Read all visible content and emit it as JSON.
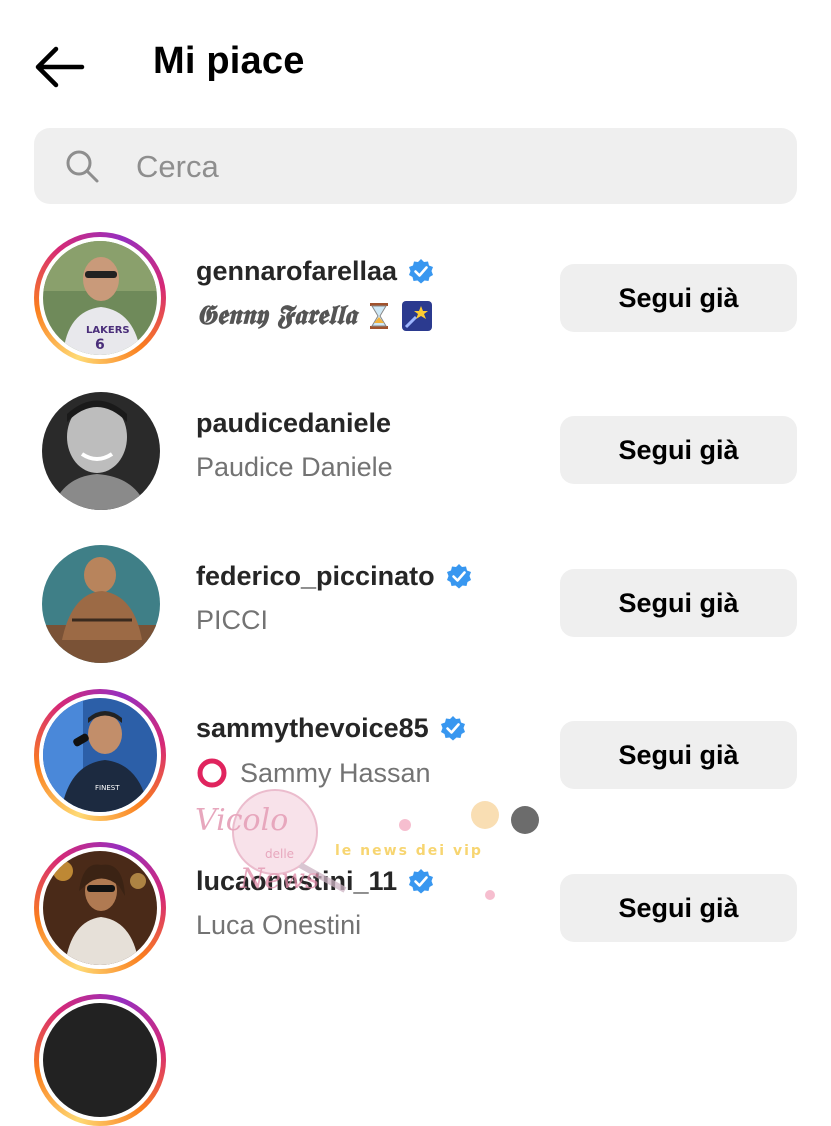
{
  "header": {
    "title": "Mi piace",
    "back_icon": "arrow-left-icon"
  },
  "search": {
    "placeholder": "Cerca",
    "icon": "search-icon"
  },
  "users": [
    {
      "username": "gennarofarellaa",
      "fullname": "𝕲𝖊𝖓𝖓𝖞 𝕱𝖆𝖗𝖊𝖑𝖑𝖆",
      "verified": true,
      "story_ring": true,
      "emojis": [
        "hourglass-emoji",
        "shooting-star-emoji"
      ],
      "button": "Segui già"
    },
    {
      "username": "paudicedaniele",
      "fullname": "Paudice Daniele",
      "verified": false,
      "story_ring": false,
      "button": "Segui già"
    },
    {
      "username": "federico_piccinato",
      "fullname": "PICCI",
      "verified": true,
      "story_ring": false,
      "button": "Segui già"
    },
    {
      "username": "sammythevoice85",
      "fullname": "Sammy Hassan",
      "fullname_prefix": "⭕",
      "verified": true,
      "story_ring": true,
      "button": "Segui già"
    },
    {
      "username": "lucaonestini_11",
      "fullname": "Luca Onestini",
      "verified": true,
      "story_ring": true,
      "button": "Segui già"
    }
  ],
  "watermark": {
    "line1": "Vicolo",
    "line2": "delle",
    "line3": "News",
    "tagline": "le news dei vip"
  },
  "colors": {
    "verified_blue": "#3897f0",
    "button_bg": "#efefef",
    "search_bg": "#efefef",
    "secondary_text": "#737373"
  }
}
